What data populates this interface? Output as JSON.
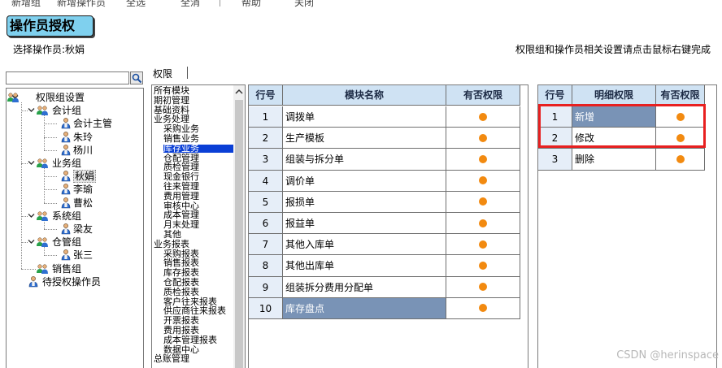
{
  "toolbar": {
    "items": [
      "新增组",
      "新增操作员",
      "全选",
      "全消",
      "帮助",
      "关闭"
    ]
  },
  "header": {
    "title": "操作员授权",
    "select_label": "选择操作员:秋娟",
    "hint": "权限组和操作员相关设置请点击鼠标右键完成"
  },
  "search": {
    "value": ""
  },
  "tree": {
    "root": "权限组设置",
    "groups": [
      {
        "label": "会计组",
        "members": [
          "会计主管",
          "朱玲",
          "杨川"
        ]
      },
      {
        "label": "业务组",
        "members": [
          "秋娟",
          "李瑜",
          "曹松"
        ]
      },
      {
        "label": "系统组",
        "members": [
          "梁友"
        ]
      },
      {
        "label": "仓管组",
        "members": [
          "张三"
        ]
      },
      {
        "label": "销售组",
        "members": []
      }
    ],
    "pending": "待授权操作员",
    "selected": "秋娟"
  },
  "tab": {
    "label": "权限"
  },
  "modules": {
    "items": [
      "所有模块",
      "期初管理",
      "基础资料",
      "业务处理",
      "采购业务",
      "销售业务",
      "库存业务",
      "仓配管理",
      "质检管理",
      "现金银行",
      "往来管理",
      "费用管理",
      "审核中心",
      "成本管理",
      "月末处理",
      "其他",
      "业务报表",
      "采购报表",
      "销售报表",
      "库存报表",
      "仓配报表",
      "质检报表",
      "客户往来报表",
      "供应商往来报表",
      "开票报表",
      "费用报表",
      "成本管理报表",
      "数据中心",
      "总账管理"
    ],
    "selected": "库存业务"
  },
  "module_grid": {
    "headers": [
      "行号",
      "模块名称",
      "有否权限"
    ],
    "rows": [
      {
        "no": "1",
        "name": "调拨单",
        "has": true
      },
      {
        "no": "2",
        "name": "生产模板",
        "has": true
      },
      {
        "no": "3",
        "name": "组装与拆分单",
        "has": true
      },
      {
        "no": "4",
        "name": "调价单",
        "has": true
      },
      {
        "no": "5",
        "name": "报损单",
        "has": true
      },
      {
        "no": "6",
        "name": "报益单",
        "has": true
      },
      {
        "no": "7",
        "name": "其他入库单",
        "has": true
      },
      {
        "no": "8",
        "name": "其他出库单",
        "has": true
      },
      {
        "no": "9",
        "name": "组装拆分费用分配单",
        "has": true
      },
      {
        "no": "10",
        "name": "库存盘点",
        "has": true
      }
    ]
  },
  "detail_grid": {
    "headers": [
      "行号",
      "明细权限",
      "有否权限"
    ],
    "rows": [
      {
        "no": "1",
        "name": "新增",
        "has": true
      },
      {
        "no": "2",
        "name": "修改",
        "has": true
      },
      {
        "no": "3",
        "name": "删除",
        "has": true
      }
    ]
  },
  "colors": {
    "accent": "#7fd0ee",
    "header_bg": "#cfe2f3",
    "highlight": "#7993b6",
    "dot": "#f28a10",
    "annotation": "#e82020"
  },
  "watermark": "CSDN @herinspace"
}
